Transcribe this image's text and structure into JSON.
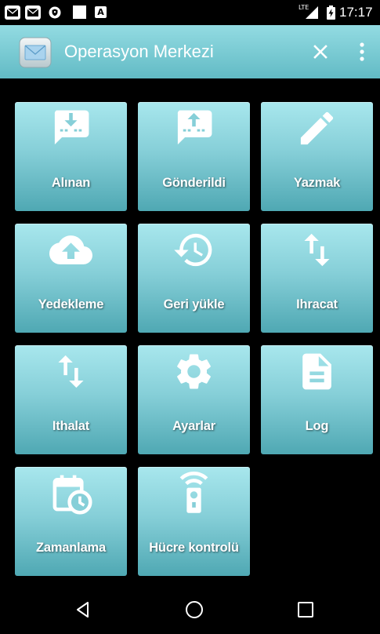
{
  "status_bar": {
    "time": "17:17",
    "network_label": "LTE",
    "a_glyph": "A",
    "left_icons": [
      "email-notification-icon",
      "email-notification-icon",
      "vpn-key-icon",
      "blank-notification-icon",
      "a-notification-icon"
    ],
    "right_icons": [
      "signal-icon",
      "battery-charging-icon"
    ]
  },
  "app_bar": {
    "title": "Operasyon Merkezi",
    "app_icon": "envelope-app-icon",
    "close_icon": "close-icon",
    "menu_icon": "overflow-menu-icon"
  },
  "tiles": [
    {
      "label": "Alınan",
      "icon": "inbox-download-icon"
    },
    {
      "label": "Gönderildi",
      "icon": "outbox-upload-icon"
    },
    {
      "label": "Yazmak",
      "icon": "pencil-icon"
    },
    {
      "label": "Yedekleme",
      "icon": "cloud-upload-icon"
    },
    {
      "label": "Geri yükle",
      "icon": "restore-icon"
    },
    {
      "label": "Ihracat",
      "icon": "swap-vertical-icon"
    },
    {
      "label": "Ithalat",
      "icon": "swap-vertical-icon"
    },
    {
      "label": "Ayarlar",
      "icon": "gear-icon"
    },
    {
      "label": "Log",
      "icon": "document-icon"
    },
    {
      "label": "Zamanlama",
      "icon": "calendar-clock-icon"
    },
    {
      "label": "Hücre kontrolü",
      "icon": "remote-control-icon"
    }
  ],
  "nav_bar": {
    "buttons": [
      "back-icon",
      "home-icon",
      "recents-icon"
    ]
  },
  "colors": {
    "status_bar_bg": "#000000",
    "app_bar_top": "#93dbe2",
    "app_bar_bottom": "#62bbc5",
    "tile_top": "#a8e7ed",
    "tile_mid": "#86cfd8",
    "tile_bottom": "#4fa8b3",
    "background": "#000000",
    "text": "#ffffff"
  }
}
